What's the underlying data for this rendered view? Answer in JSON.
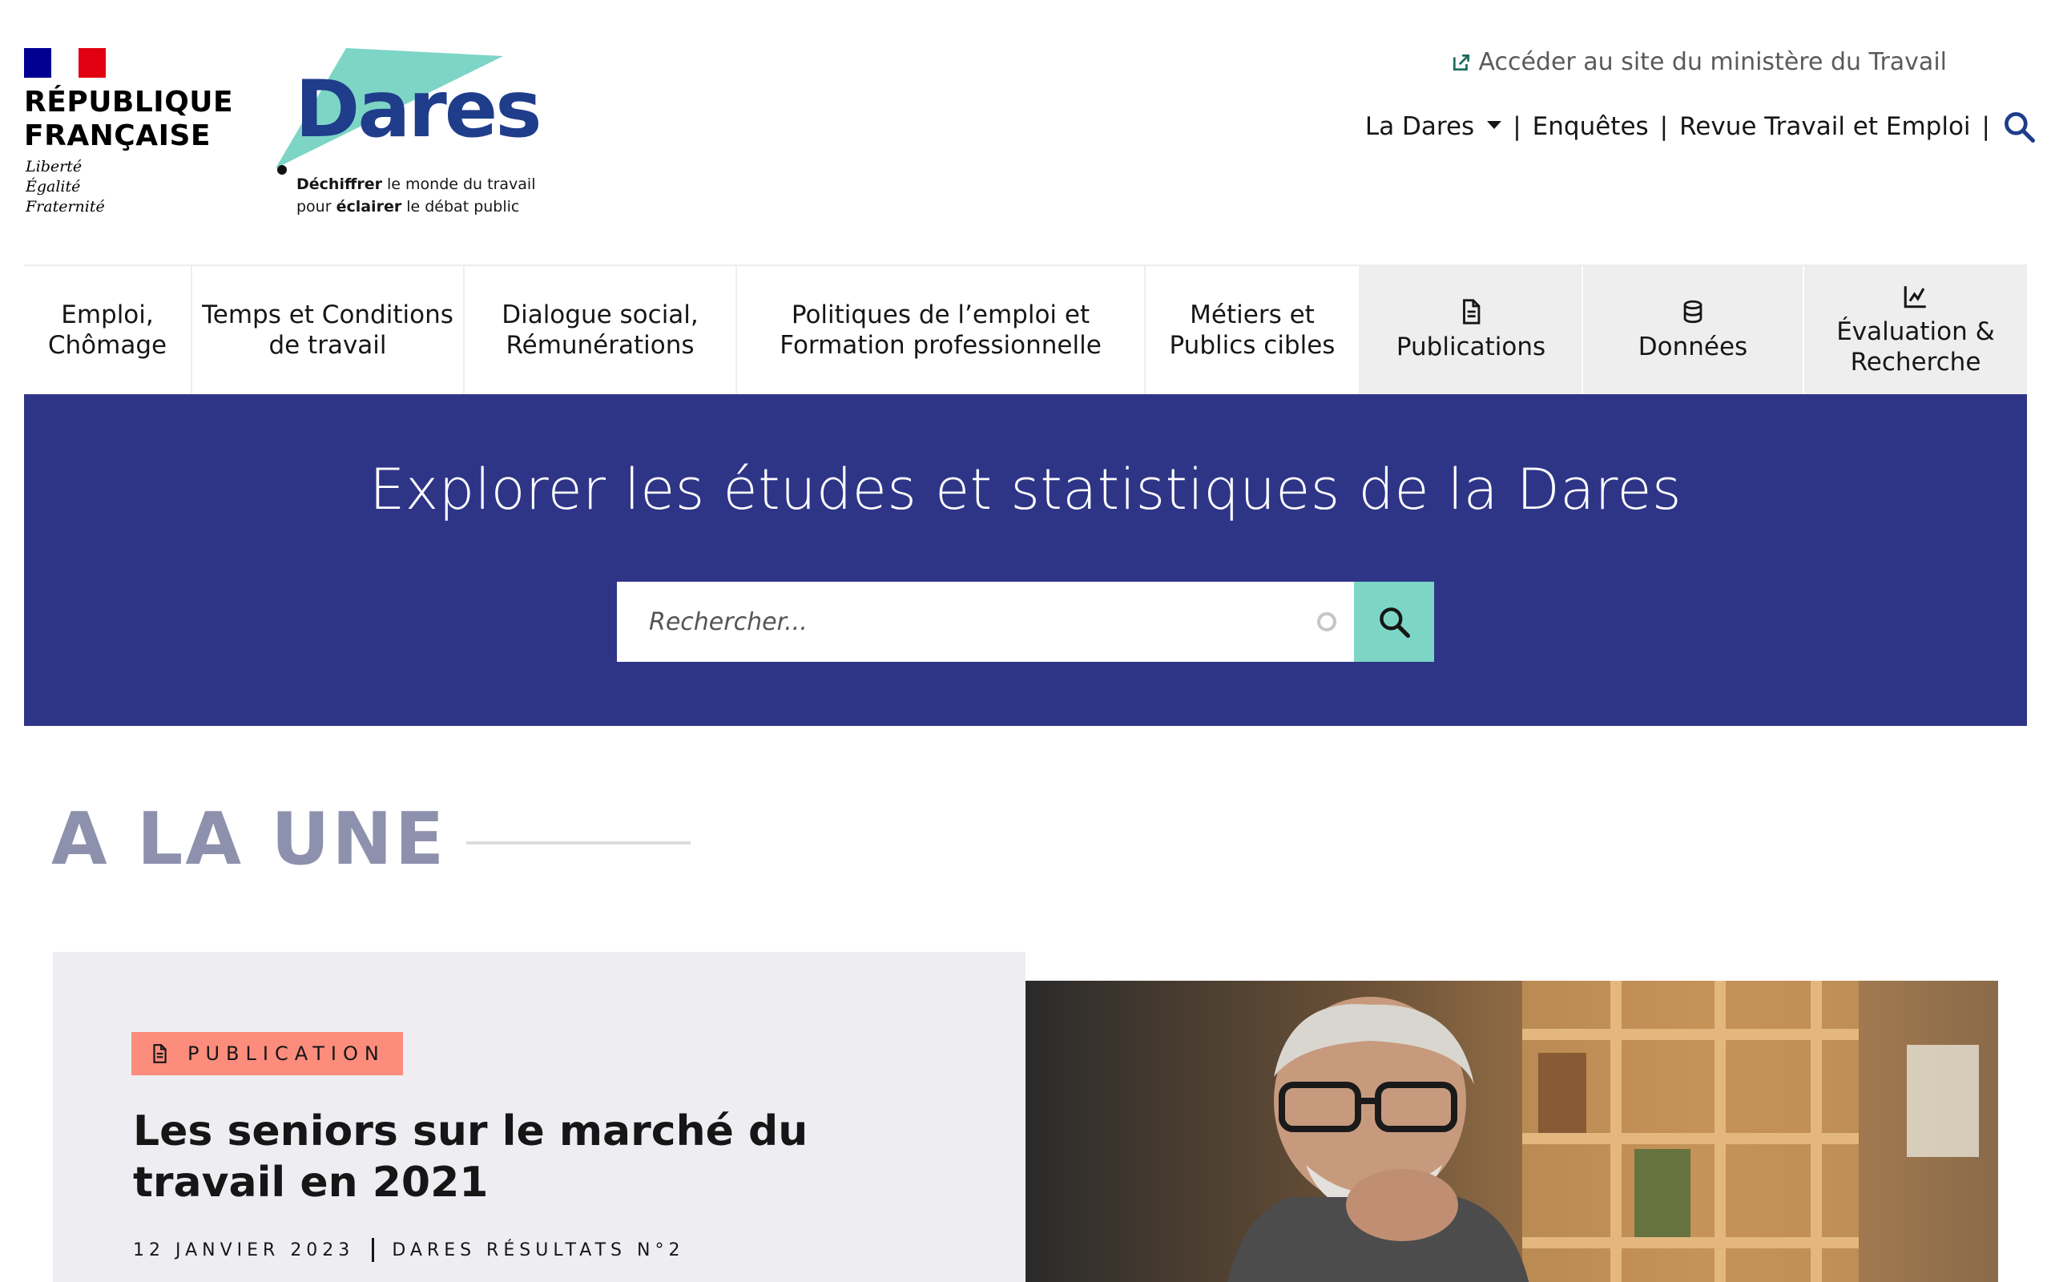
{
  "brand": {
    "rf_name_line1": "RÉPUBLIQUE",
    "rf_name_line2": "FRANÇAISE",
    "rf_motto_1": "Liberté",
    "rf_motto_2": "Égalité",
    "rf_motto_3": "Fraternité",
    "dares_wordmark": "Dares",
    "tagline_1_bold": "Déchiffrer",
    "tagline_1_rest": " le monde du travail",
    "tagline_2_pre": "pour ",
    "tagline_2_bold": "éclairer",
    "tagline_2_rest": " le débat public",
    "colors": {
      "dares_blue": "#1f3d8a",
      "teal": "#7dd5c6",
      "hero_blue": "#2e3587",
      "badge": "#fc8c7c"
    }
  },
  "header": {
    "external_link": "Accéder au site du ministère du Travail",
    "external_icon": "external-link-icon",
    "top_nav": [
      {
        "label": "La Dares",
        "has_dropdown": true
      },
      {
        "label": "Enquêtes"
      },
      {
        "label": "Revue Travail et Emploi"
      }
    ],
    "separator": "|",
    "search_icon": "search-icon"
  },
  "main_nav": [
    {
      "label_1": "Emploi,",
      "label_2": "Chômage"
    },
    {
      "label_1": "Temps et Conditions",
      "label_2": "de travail"
    },
    {
      "label_1": "Dialogue social,",
      "label_2": "Rémunérations"
    },
    {
      "label_1": "Politiques de l’emploi et",
      "label_2": "Formation professionnelle"
    },
    {
      "label_1": "Métiers et",
      "label_2": "Publics cibles"
    },
    {
      "label_1": "Publications",
      "icon": "document-icon"
    },
    {
      "label_1": "Données",
      "icon": "database-icon"
    },
    {
      "label_1": "Évaluation &",
      "label_2": "Recherche",
      "icon": "chart-line-icon"
    }
  ],
  "hero": {
    "title": "Explorer les études et statistiques de la Dares",
    "search_placeholder": "Rechercher..."
  },
  "une": {
    "heading": "A LA UNE",
    "card": {
      "badge": "PUBLICATION",
      "badge_icon": "document-icon",
      "title": "Les seniors sur le marché du travail en 2021",
      "date": "12 JANVIER 2023",
      "series": "DARES RÉSULTATS N°2"
    }
  }
}
